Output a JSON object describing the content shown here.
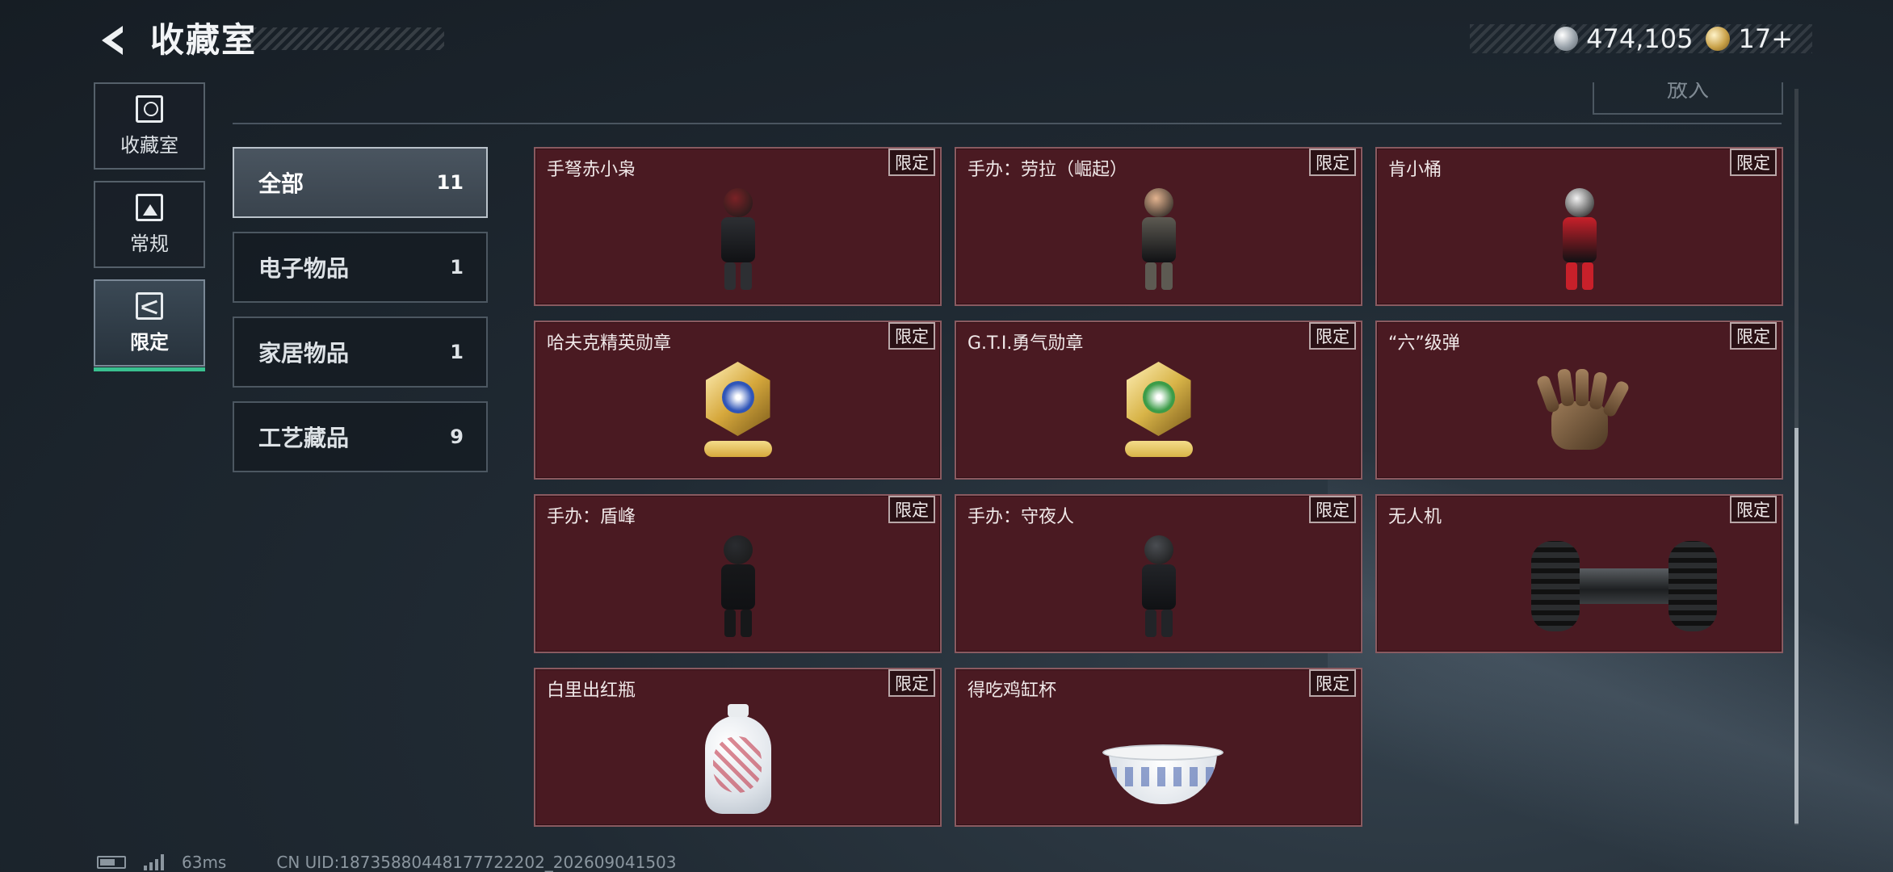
{
  "header": {
    "title": "收藏室",
    "currencies": [
      {
        "icon": "silver-coin-icon",
        "value": "474,105"
      },
      {
        "icon": "gold-coin-icon",
        "value": "17+"
      }
    ]
  },
  "side_nav": {
    "items": [
      {
        "label": "收藏室",
        "icon": "trophy-icon",
        "active": false
      },
      {
        "label": "常规",
        "icon": "document-icon",
        "active": false
      },
      {
        "label": "限定",
        "icon": "limited-icon",
        "active": true
      }
    ]
  },
  "top_section": {
    "put_in_label": "放入"
  },
  "categories": [
    {
      "name": "全部",
      "count": "11",
      "active": true
    },
    {
      "name": "电子物品",
      "count": "1",
      "active": false
    },
    {
      "name": "家居物品",
      "count": "1",
      "active": false
    },
    {
      "name": "工艺藏品",
      "count": "9",
      "active": false
    }
  ],
  "items": [
    {
      "name": "手弩赤小枭",
      "badge": "限定",
      "art": "figure",
      "colors": [
        "#7a2226",
        "#2d2f33"
      ]
    },
    {
      "name": "手办：劳拉（崛起）",
      "badge": "限定",
      "art": "figure",
      "colors": [
        "#e3b38f",
        "#5d5a52"
      ]
    },
    {
      "name": "肯小桶",
      "badge": "限定",
      "art": "figure",
      "colors": [
        "#f2f2f2",
        "#c8202a"
      ]
    },
    {
      "name": "哈夫克精英勋章",
      "badge": "限定",
      "art": "medal",
      "colors": [
        "#d6a83c",
        "#2f55b8"
      ]
    },
    {
      "name": "G.T.I.勇气勋章",
      "badge": "限定",
      "art": "medal",
      "colors": [
        "#d8b448",
        "#3c9c48"
      ]
    },
    {
      "name": "“六”级弹",
      "badge": "限定",
      "art": "hand",
      "colors": [
        "#9b7a57"
      ]
    },
    {
      "name": "手办：盾峰",
      "badge": "限定",
      "art": "figure",
      "colors": [
        "#2a2c30",
        "#17181a"
      ]
    },
    {
      "name": "手办：守夜人",
      "badge": "限定",
      "art": "figure",
      "colors": [
        "#4a4d52",
        "#222428"
      ]
    },
    {
      "name": "无人机",
      "badge": "限定",
      "art": "drone",
      "colors": [
        "#2b2d2f"
      ]
    },
    {
      "name": "白里出红瓶",
      "badge": "限定",
      "art": "vase",
      "colors": [
        "#e9ecef",
        "#be283c"
      ]
    },
    {
      "name": "得吃鸡缸杯",
      "badge": "限定",
      "art": "bowl",
      "colors": [
        "#f3f4f5",
        "#3c5aaa"
      ]
    }
  ],
  "status_bar": {
    "ping": "63ms",
    "uid": "CN UID:18735880448177722202_202609041503"
  },
  "colors": {
    "accent_green": "#39c08f",
    "card_bg": "#4a1a22"
  }
}
